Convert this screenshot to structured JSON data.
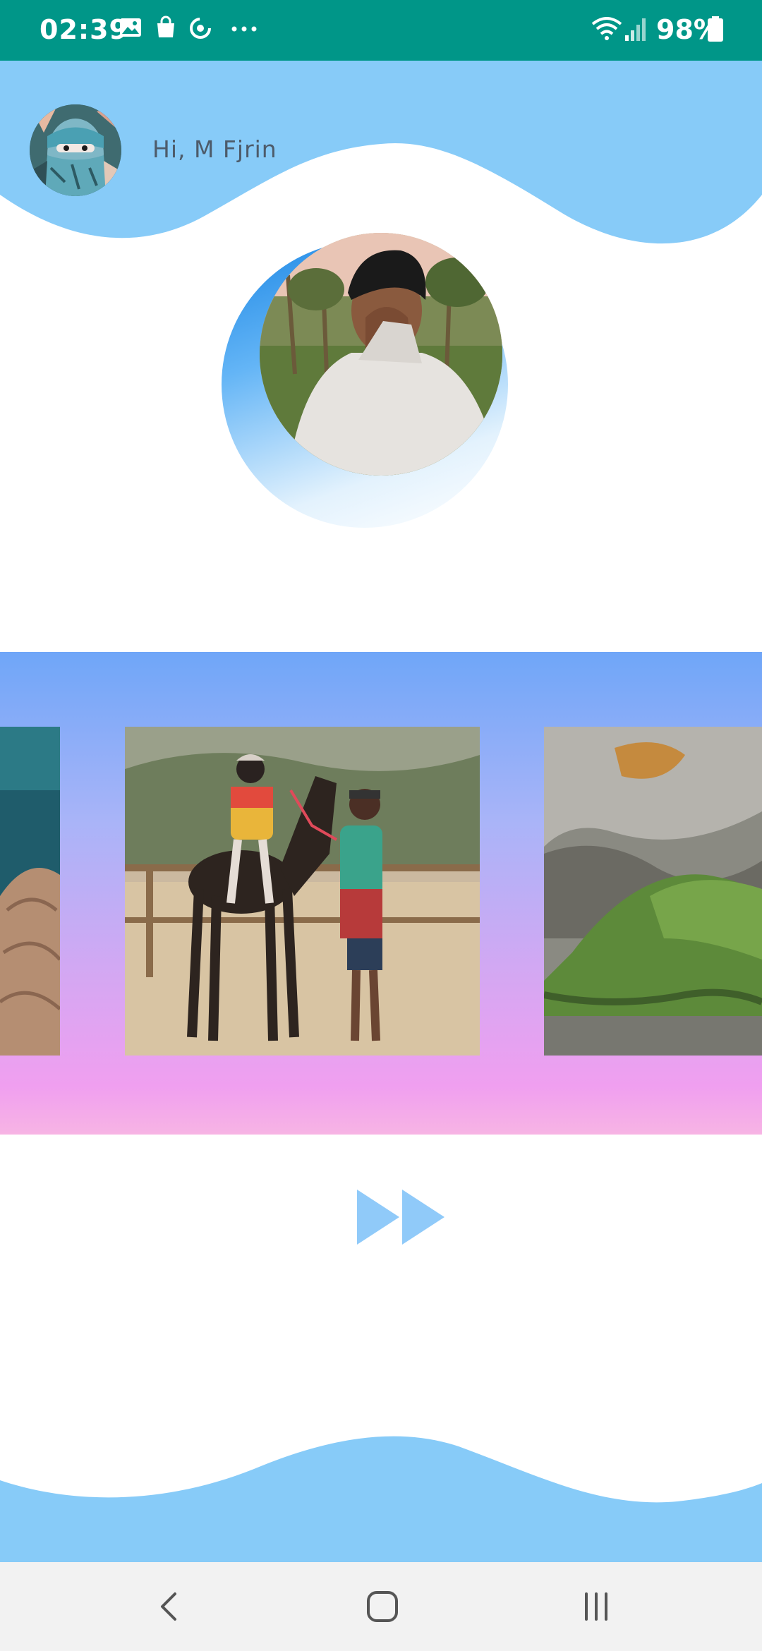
{
  "status_bar": {
    "time": "02:39",
    "battery": "98%",
    "icons": [
      "image-icon",
      "shopping-bag-icon",
      "sync-icon",
      "more-icon",
      "wifi-icon",
      "signal-icon",
      "battery-icon"
    ]
  },
  "header": {
    "greeting": "Hi, M Fjrin",
    "avatar_icon": "masked-person-avatar"
  },
  "profile": {
    "photo_icon": "profile-photo"
  },
  "carousel": {
    "slides": [
      "coast-rock-photo",
      "horse-rider-photo",
      "crater-landscape-photo"
    ]
  },
  "actions": {
    "next_icon": "fast-forward-icon"
  },
  "nav_bar": {
    "icons": [
      "back-icon",
      "home-icon",
      "recent-apps-icon"
    ]
  },
  "colors": {
    "status_bar": "#009688",
    "wave": "#87cbf8",
    "accent": "#90caf9",
    "greeting_text": "#4d5b6a"
  }
}
